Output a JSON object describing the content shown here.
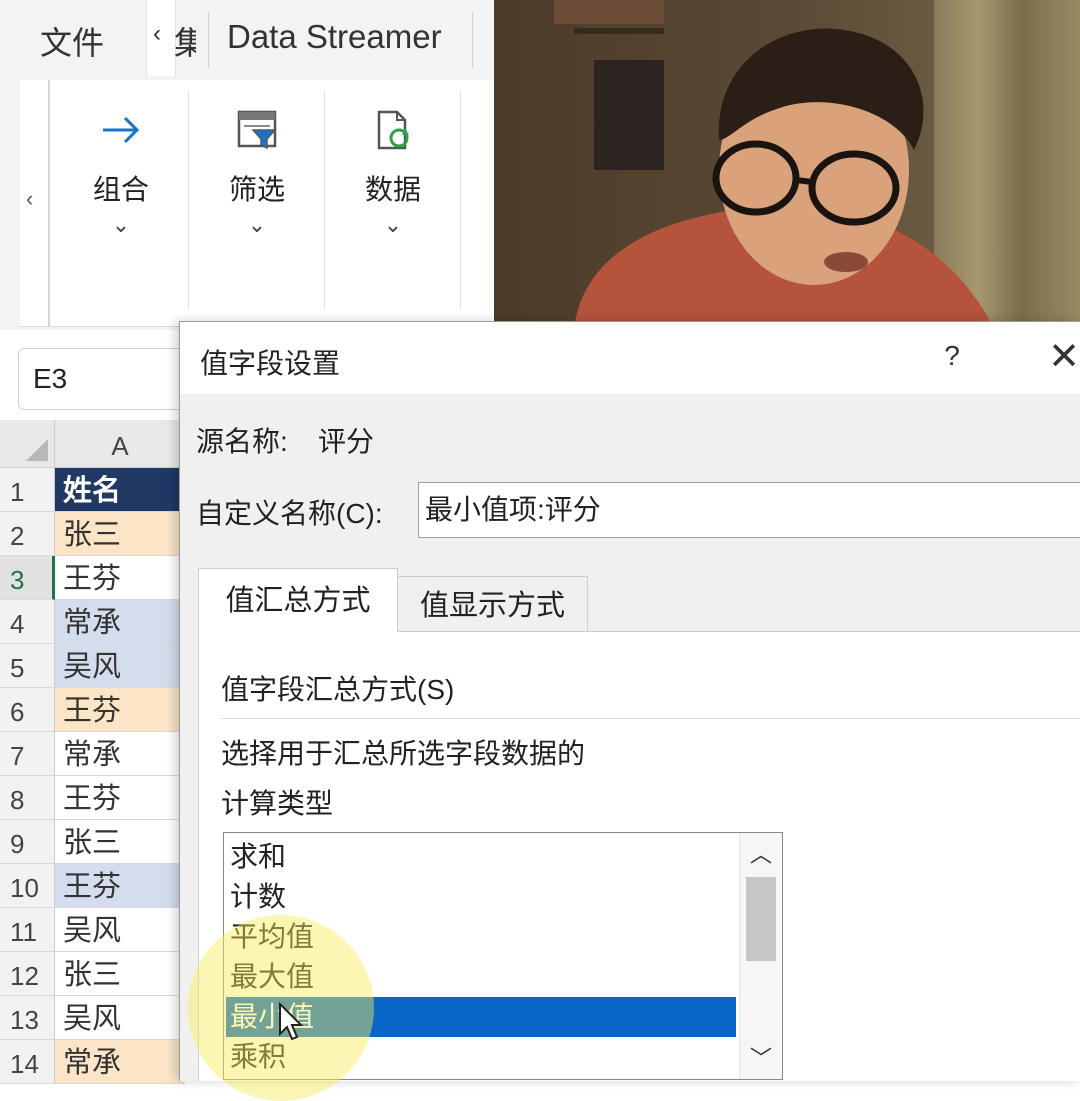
{
  "ribbon": {
    "tab_file": "文件",
    "tab_partial": "集",
    "tab_data_streamer": "Data Streamer",
    "groups": [
      {
        "label": "组合",
        "icon": "arrow-right-icon"
      },
      {
        "label": "筛选",
        "icon": "filter-icon"
      },
      {
        "label": "数据",
        "icon": "refresh-data-icon"
      }
    ]
  },
  "namebox": {
    "value": "E3"
  },
  "sheet": {
    "column_header": "A",
    "rows": [
      {
        "num": "1",
        "value": "姓名"
      },
      {
        "num": "2",
        "value": "张三"
      },
      {
        "num": "3",
        "value": "王芬"
      },
      {
        "num": "4",
        "value": "常承"
      },
      {
        "num": "5",
        "value": "吴风"
      },
      {
        "num": "6",
        "value": "王芬"
      },
      {
        "num": "7",
        "value": "常承"
      },
      {
        "num": "8",
        "value": "王芬"
      },
      {
        "num": "9",
        "value": "张三"
      },
      {
        "num": "10",
        "value": "王芬"
      },
      {
        "num": "11",
        "value": "吴风"
      },
      {
        "num": "12",
        "value": "张三"
      },
      {
        "num": "13",
        "value": "吴风"
      },
      {
        "num": "14",
        "value": "常承"
      }
    ]
  },
  "dialog": {
    "title": "值字段设置",
    "help": "?",
    "close": "✕",
    "source_label": "源名称:",
    "source_value": "评分",
    "custom_label": "自定义名称(C):",
    "custom_value": "最小值项:评分",
    "tabs": [
      "值汇总方式",
      "值显示方式"
    ],
    "section_title": "值字段汇总方式(S)",
    "description_line1": "选择用于汇总所选字段数据的",
    "description_line2": "计算类型",
    "list_items": [
      "求和",
      "计数",
      "平均值",
      "最大值",
      "最小值",
      "乘积"
    ],
    "selected_item": "最小值"
  },
  "colors": {
    "header_fill": "#1f3864",
    "highlight_orange": "#fbe5c6",
    "highlight_blue": "#d4dded",
    "selection": "#0a66c9",
    "excel_green": "#217346"
  }
}
